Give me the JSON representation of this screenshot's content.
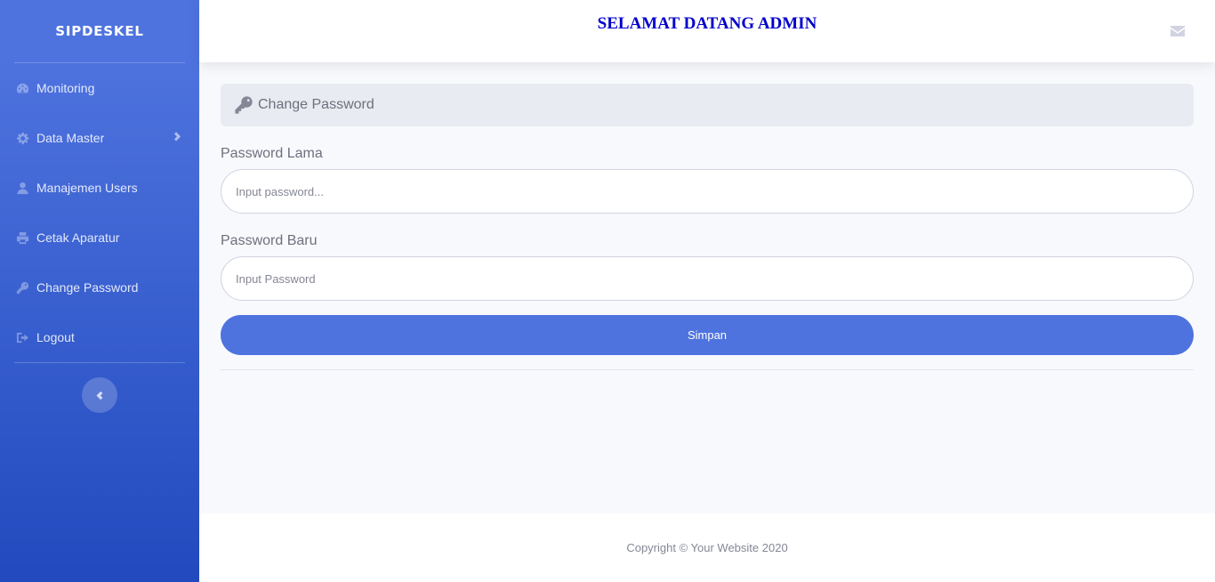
{
  "sidebar": {
    "brand": "SIPDESKEL",
    "items": [
      {
        "label": "Monitoring",
        "icon": "tachometer-icon"
      },
      {
        "label": "Data Master",
        "icon": "cog-icon"
      },
      {
        "label": "Manajemen Users",
        "icon": "user-icon"
      },
      {
        "label": "Cetak Aparatur",
        "icon": "print-icon"
      },
      {
        "label": "Change Password",
        "icon": "key-icon"
      },
      {
        "label": "Logout",
        "icon": "sign-out-icon"
      }
    ],
    "toggle_icon": "chevron-left-icon"
  },
  "topbar": {
    "title": "SELAMAT DATANG ADMIN",
    "title_color": "#0000cc",
    "mail_icon": "envelope-icon"
  },
  "main": {
    "header": "Change Password",
    "old_password": {
      "label": "Password Lama",
      "placeholder": "Input password...",
      "value": ""
    },
    "new_password": {
      "label": "Password Baru",
      "placeholder": "Input Password",
      "value": ""
    },
    "submit_label": "Simpan"
  },
  "footer": {
    "copyright": "Copyright © Your Website 2020"
  },
  "colors": {
    "accent": "#4e73df",
    "sidebar_gradient_start": "#4e73df",
    "sidebar_gradient_end": "#224abe"
  }
}
